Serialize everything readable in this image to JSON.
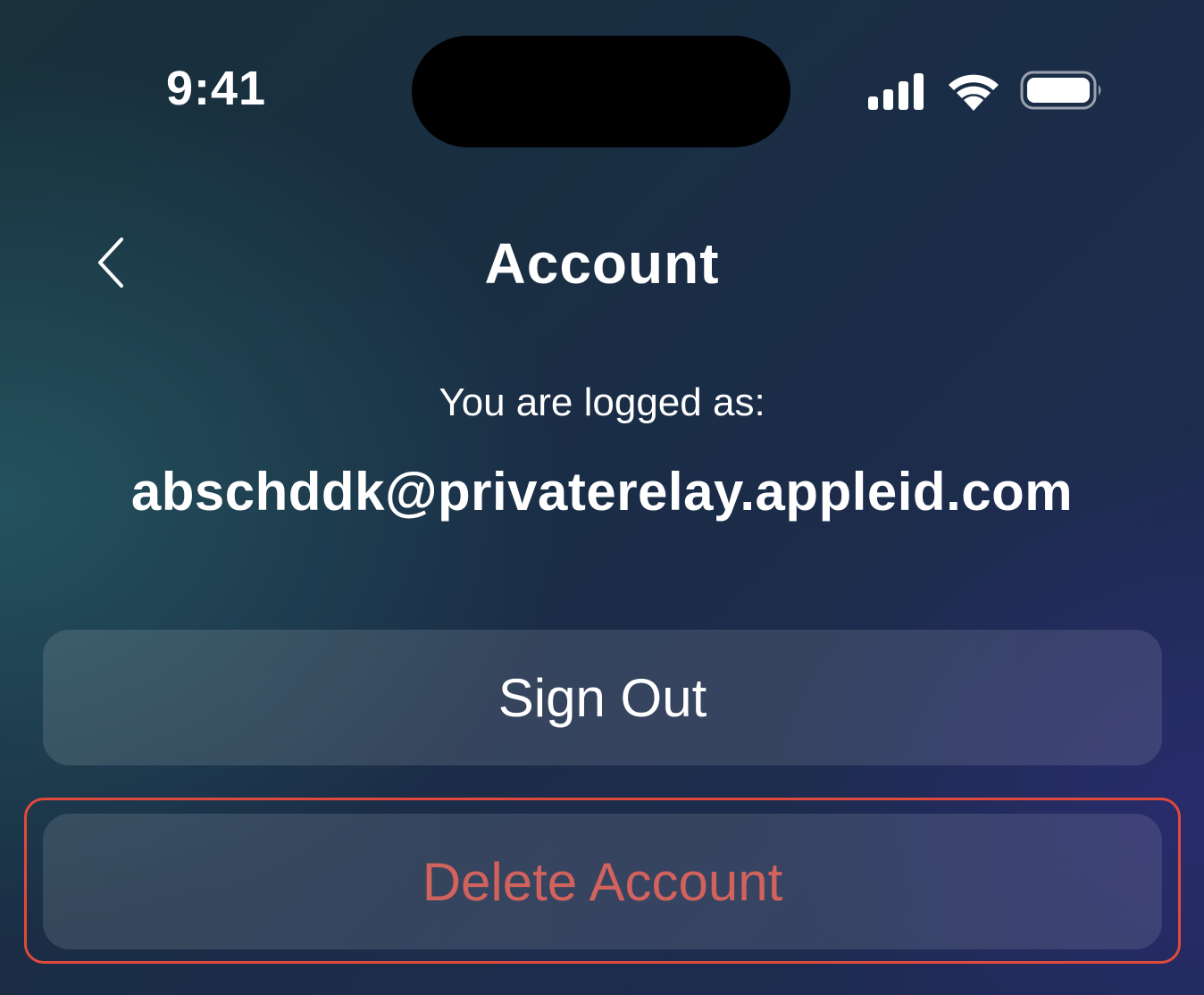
{
  "status_bar": {
    "time": "9:41",
    "icons": [
      "cellular-signal-icon",
      "wifi-icon",
      "battery-icon"
    ]
  },
  "nav": {
    "back_icon": "chevron-left-icon",
    "title": "Account"
  },
  "account": {
    "logged_label": "You are logged as:",
    "email": "abschddk@privaterelay.appleid.com"
  },
  "actions": {
    "sign_out_label": "Sign Out",
    "delete_account_label": "Delete Account"
  },
  "colors": {
    "danger_text": "#d1625c",
    "highlight_border": "#e04a3c",
    "text": "#ffffff"
  }
}
